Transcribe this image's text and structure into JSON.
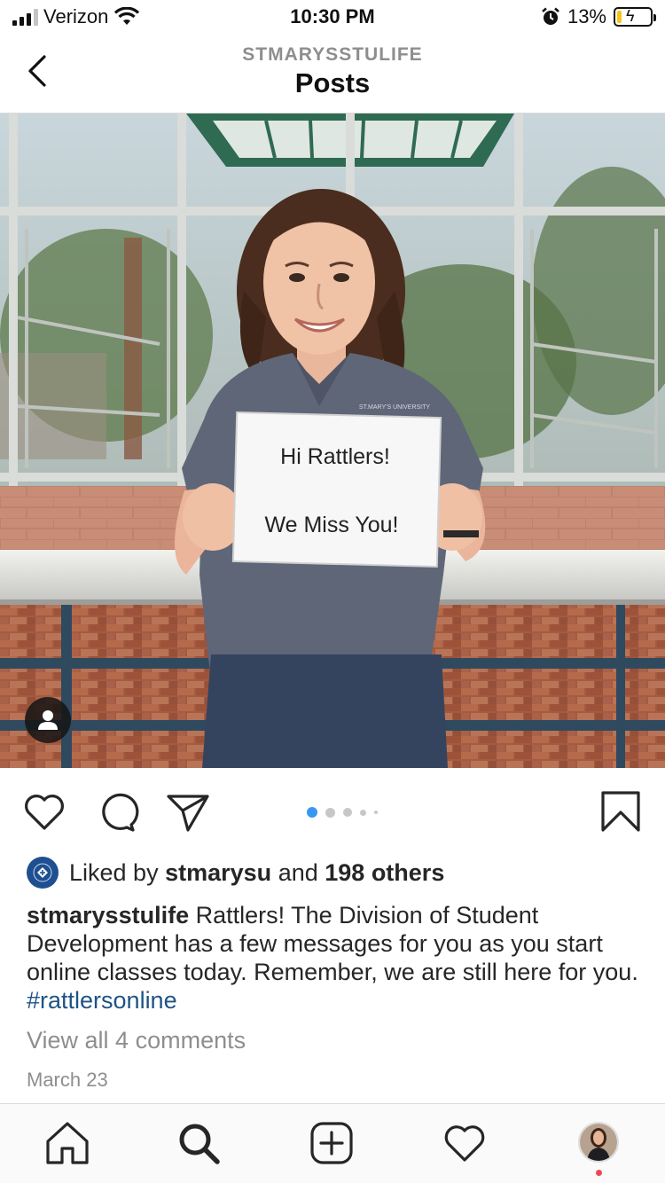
{
  "status_bar": {
    "carrier": "Verizon",
    "time": "10:30 PM",
    "battery_percent": "13%",
    "battery_level": 0.13,
    "icons": [
      "signal-icon",
      "wifi-icon",
      "alarm-icon",
      "battery-icon"
    ]
  },
  "header": {
    "account": "STMARYSSTULIFE",
    "title": "Posts"
  },
  "post": {
    "sign_line1": "Hi Rattlers!",
    "sign_line2": "We Miss You!",
    "shirt_text": "ST.MARY'S UNIVERSITY",
    "carousel_count": 5,
    "carousel_active": 0,
    "likes": {
      "prefix": "Liked by",
      "user": "stmarysu",
      "and": "and",
      "count": "198 others"
    },
    "caption": {
      "user": "stmarysstulife",
      "text": " Rattlers! The Division of Student Development has a few messages for you as you start online classes today.  Remember, we are still here for you. ",
      "hashtag": "#rattlersonline"
    },
    "view_comments": "View all 4 comments",
    "date": "March 23"
  },
  "tabs": [
    "home-icon",
    "search-icon",
    "new-post-icon",
    "activity-icon",
    "profile-avatar"
  ],
  "colors": {
    "accent": "#3897f0",
    "hashtag": "#1f5387",
    "secondary_text": "#8e8e8e",
    "notification": "#ed4956"
  }
}
